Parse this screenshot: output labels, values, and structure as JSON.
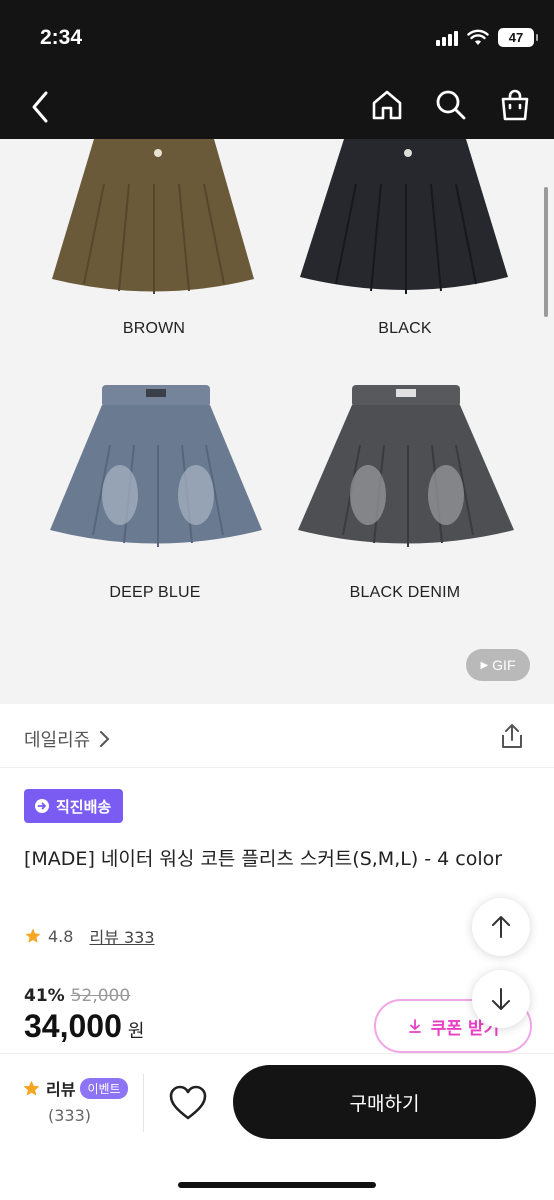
{
  "status_bar": {
    "time": "2:34",
    "battery": "47"
  },
  "nav": {
    "back_icon": "chevron-left-icon",
    "home_icon": "home-icon",
    "search_icon": "search-icon",
    "cart_icon": "shopping-bag-icon"
  },
  "gallery": {
    "colors": [
      {
        "label": "BROWN",
        "fill": "#6b5a3a"
      },
      {
        "label": "BLACK",
        "fill": "#26282d"
      },
      {
        "label": "DEEP BLUE",
        "fill": "#6a7a90"
      },
      {
        "label": "BLACK DENIM",
        "fill": "#4e4f52"
      }
    ],
    "gif_label": "GIF"
  },
  "store": {
    "name": "데일리쥬"
  },
  "product": {
    "badge": "직진배송",
    "title": "[MADE] 네이터 워싱 코튼 플리츠 스커트(S,M,L) - 4 color",
    "rating": "4.8",
    "review_link": "리뷰 333",
    "discount": "41%",
    "original_price": "52,000",
    "price": "34,000",
    "currency": "원",
    "coupon_label": "쿠폰 받기"
  },
  "bottom_bar": {
    "review_label": "리뷰",
    "event_tag": "이벤트",
    "review_count": "(333)",
    "buy_label": "구매하기"
  },
  "colors": {
    "accent_purple": "#7a5cf3",
    "coupon_pink": "#e83fc4",
    "dark": "#141414"
  }
}
